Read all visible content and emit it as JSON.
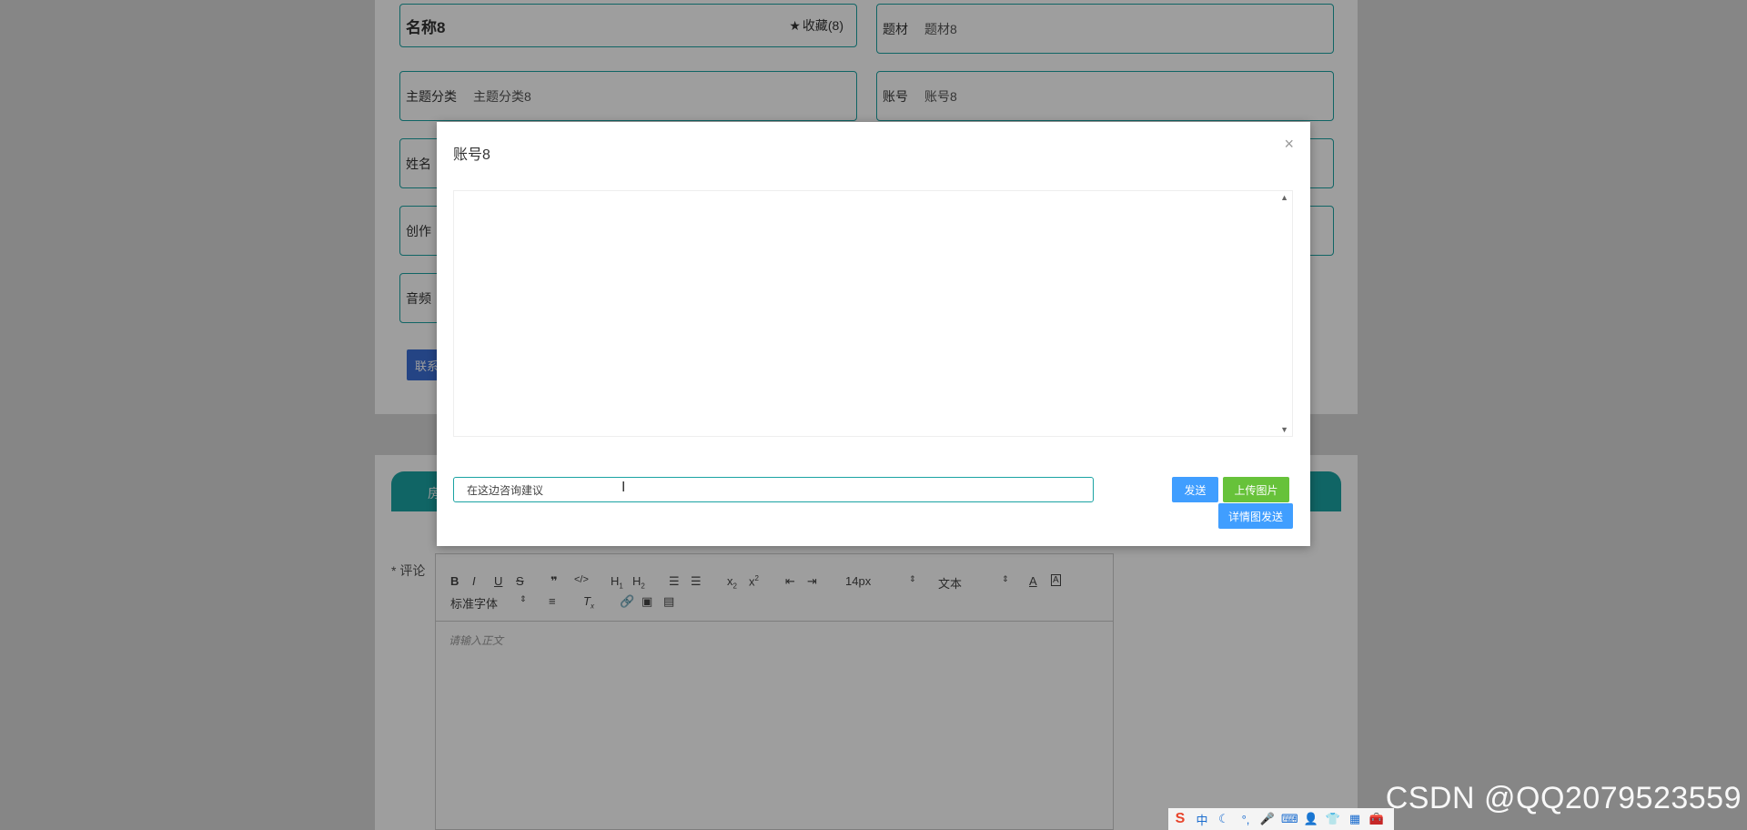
{
  "detail": {
    "title": "名称8",
    "favorite_label": "收藏(8)",
    "fields": [
      {
        "label": "题材",
        "value": "题材8"
      },
      {
        "label": "主题分类",
        "value": "主题分类8"
      },
      {
        "label": "账号",
        "value": "账号8"
      },
      {
        "label": "姓名",
        "value": ""
      },
      {
        "label": "创作",
        "value": ""
      },
      {
        "label": "音频",
        "value": ""
      }
    ],
    "contact_button": "联系"
  },
  "comment": {
    "label": "* 评论",
    "tab_label": "房",
    "toolbar": {
      "font_size": "14px",
      "text_style": "文本",
      "font_family": "标准字体"
    },
    "placeholder": "请输入正文"
  },
  "modal": {
    "title": "账号8",
    "close": "×",
    "input_value": "在这边咨询建议",
    "send_button": "发送",
    "upload_button": "上传图片",
    "detail_send_button": "详情图发送"
  },
  "colors": {
    "teal": "#1aa3a3",
    "blue": "#409eff",
    "green": "#67c23a"
  },
  "watermark": "CSDN @QQ2079523559"
}
